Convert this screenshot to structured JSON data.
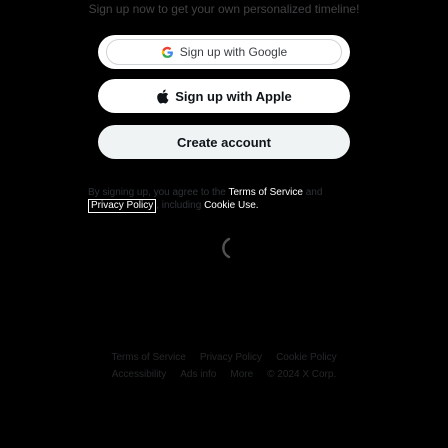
{
  "intro": {
    "text": "Sign up now to get your own personalized timeline!"
  },
  "buttons": {
    "google_label": "Sign up with Google",
    "apple_label": "Sign up with Apple",
    "create_label": "Create account"
  },
  "legal": {
    "prefix": "By signing up, you agree to the ",
    "terms": "Terms of Service",
    "and": " and ",
    "privacy": "Privacy Policy",
    "suffix": ", including ",
    "cookie": "Cookie Use."
  },
  "footer": {
    "row1": [
      "Terms of Service",
      "Privacy Policy",
      "Cookie Policy"
    ],
    "row2": [
      "Accessibility",
      "Ads info",
      "More",
      "© 2024 X Corp."
    ]
  }
}
